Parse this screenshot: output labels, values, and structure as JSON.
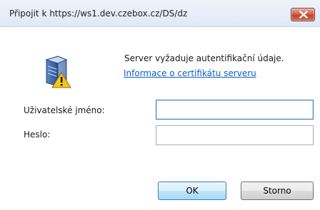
{
  "window": {
    "title": "Připojit k https://ws1.dev.czebox.cz/DS/dz"
  },
  "message": {
    "text": "Server vyžaduje autentifikační údaje.",
    "cert_link": "Informace o certifikátu serveru"
  },
  "form": {
    "username_label": "Uživatelské jméno:",
    "username_value": "",
    "password_label": "Heslo:",
    "password_value": ""
  },
  "buttons": {
    "ok": "OK",
    "cancel": "Storno"
  },
  "icons": {
    "server": "server-warning-icon",
    "close": "close-icon"
  },
  "colors": {
    "link": "#0a5fc0",
    "close_button": "#c0442c",
    "focus_border": "#3c7fb1"
  }
}
